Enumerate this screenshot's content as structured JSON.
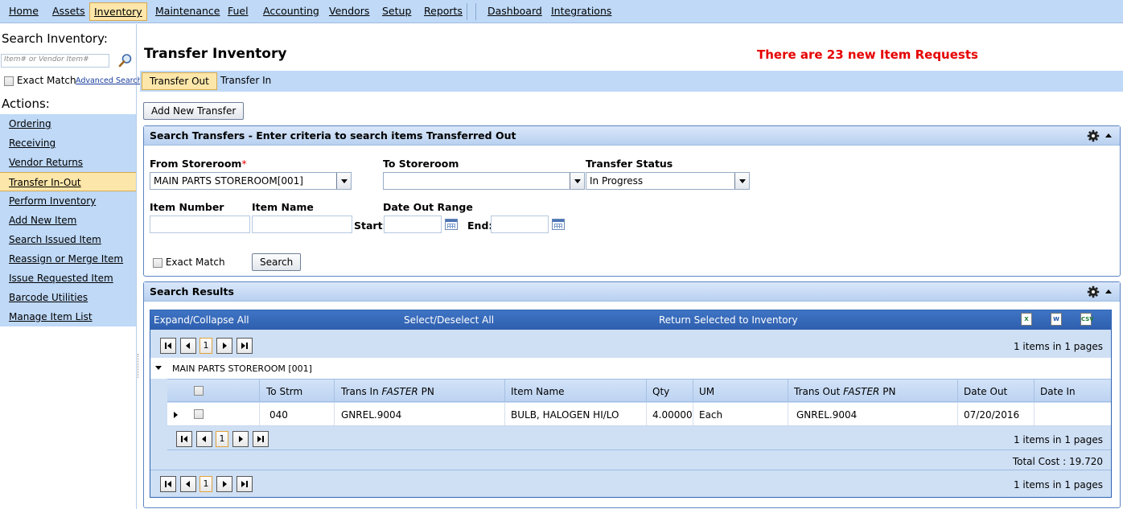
{
  "topnav": {
    "items": [
      "Home",
      "Assets",
      "Inventory",
      "Maintenance",
      "Fuel",
      "Accounting",
      "Vendors",
      "Setup",
      "Reports",
      "Dashboard",
      "Integrations"
    ]
  },
  "sidebar": {
    "search_title": "Search Inventory:",
    "search_placeholder": "Item# or Vendor Item#",
    "exact_match_label": "Exact Match",
    "advanced_search_label": "Advanced Search",
    "actions_title": "Actions:",
    "actions": [
      "Ordering",
      "Receiving",
      "Vendor Returns",
      "Transfer In-Out",
      "Perform Inventory",
      "Add New Item",
      "Search Issued Item",
      "Reassign or Merge Item",
      "Issue Requested Item",
      "Barcode Utilities",
      "Manage Item List"
    ]
  },
  "page": {
    "title": "Transfer Inventory",
    "alert": "There are 23 new Item Requests",
    "tabs": [
      "Transfer Out",
      "Transfer In"
    ],
    "add_button": "Add New Transfer"
  },
  "search_panel": {
    "title": "Search Transfers - Enter criteria to search items Transferred Out",
    "from_label": "From Storeroom",
    "required_mark": "*",
    "from_value": "MAIN PARTS STOREROOM[001]",
    "to_label": "To Storeroom",
    "to_value": "",
    "status_label": "Transfer Status",
    "status_value": "In Progress",
    "item_number_label": "Item Number",
    "item_name_label": "Item Name",
    "date_range_label": "Date Out Range",
    "start_label": "Start:",
    "end_label": "End:",
    "exact_match_label": "Exact Match",
    "search_button": "Search"
  },
  "results_panel": {
    "title": "Search Results",
    "commands": [
      "Expand/Collapse All",
      "Select/Deselect All",
      "Return Selected to Inventory"
    ],
    "export_icons": [
      "excel-export-icon",
      "word-export-icon",
      "csv-export-icon"
    ],
    "export_labels": [
      "X",
      "W",
      "CSV"
    ],
    "page_number": "1",
    "page_info": "1 items in 1 pages",
    "group_label": "MAIN PARTS STOREROOM [001]",
    "columns": {
      "to_strm": "To Strm",
      "trans_in_prefix": "Trans In ",
      "brand": "FASTER",
      "pn_suffix": " PN",
      "item_name": "Item Name",
      "qty": "Qty",
      "um": "UM",
      "trans_out_prefix": "Trans Out ",
      "date_out": "Date Out",
      "date_in": "Date In"
    },
    "rows": [
      {
        "to_strm": "040",
        "trans_in_pn": "GNREL.9004",
        "item_name": "BULB, HALOGEN HI/LO",
        "qty": "4.00000",
        "um": "Each",
        "trans_out_pn": "GNREL.9004",
        "date_out": "07/20/2016",
        "date_in": ""
      }
    ],
    "total_cost": "Total Cost : 19.720"
  }
}
